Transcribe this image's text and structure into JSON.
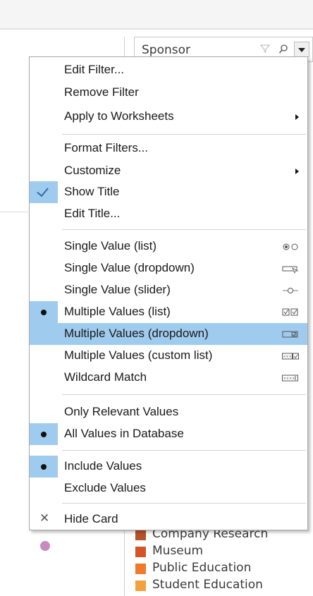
{
  "filter_card": {
    "title": "Sponsor",
    "filter_icon": "funnel-icon",
    "search_icon": "search-icon",
    "menu_icon": "chevron-down-icon"
  },
  "menu": {
    "edit_filter": "Edit Filter...",
    "remove_filter": "Remove Filter",
    "apply_to_worksheets": "Apply to Worksheets",
    "format_filters": "Format Filters...",
    "customize": "Customize",
    "show_title": "Show Title",
    "edit_title": "Edit Title...",
    "single_value_list": "Single Value (list)",
    "single_value_dropdown": "Single Value (dropdown)",
    "single_value_slider": "Single Value (slider)",
    "multiple_values_list": "Multiple Values (list)",
    "multiple_values_dropdown": "Multiple Values (dropdown)",
    "multiple_values_custom_list": "Multiple Values (custom list)",
    "wildcard_match": "Wildcard Match",
    "only_relevant_values": "Only Relevant Values",
    "all_values_in_database": "All Values in Database",
    "include_values": "Include Values",
    "exclude_values": "Exclude Values",
    "hide_card": "Hide Card",
    "highlighted_item": "Multiple Values (dropdown)",
    "checked_items": [
      "Show Title"
    ],
    "selected_items": [
      "Multiple Values (list)",
      "All Values in Database",
      "Include Values"
    ]
  },
  "legend": {
    "items": [
      {
        "label": "Company Research",
        "color": "#b5532c"
      },
      {
        "label": "Museum",
        "color": "#d3532a"
      },
      {
        "label": "Public Education",
        "color": "#f07a29"
      },
      {
        "label": "Student Education",
        "color": "#f2a13c"
      }
    ]
  },
  "colors": {
    "highlight": "#9fcbee",
    "mark_point": "#c98ac0"
  }
}
